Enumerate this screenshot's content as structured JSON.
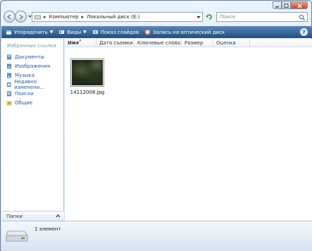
{
  "window": {
    "caption_buttons": [
      "minimize",
      "maximize",
      "close"
    ]
  },
  "address": {
    "segments": [
      "Компьютер",
      "Локальный диск (E:)"
    ]
  },
  "search": {
    "placeholder": "Поиск"
  },
  "toolbar": {
    "organize": "Упорядочить",
    "views": "Виды",
    "slideshow": "Показ слайдов",
    "burn": "Запись на оптический диск",
    "help": "?"
  },
  "navpane": {
    "heading": "Избранные ссылки",
    "items": [
      {
        "label": "Документы",
        "icon": "documents-icon"
      },
      {
        "label": "Изображения",
        "icon": "pictures-icon"
      },
      {
        "label": "Музыка",
        "icon": "music-icon"
      },
      {
        "label": "Недавно изменени...",
        "icon": "recent-icon"
      },
      {
        "label": "Поиски",
        "icon": "searches-icon"
      },
      {
        "label": "Общие",
        "icon": "public-icon"
      }
    ],
    "folders_label": "Папки"
  },
  "columns": [
    "Имя",
    "Дата съемки",
    "Ключевые слова",
    "Размер",
    "Оценка"
  ],
  "files": [
    {
      "name": "14112008.jpg"
    }
  ],
  "details": {
    "count_text": "1 элемент"
  },
  "colors": {
    "toolbar": "#2d5d91",
    "link": "#2257a7"
  }
}
